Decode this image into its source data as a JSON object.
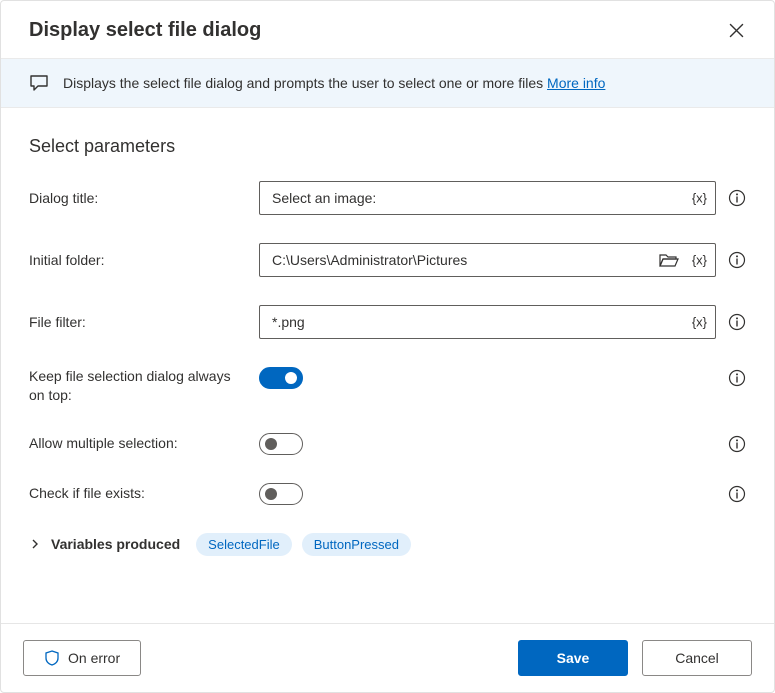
{
  "dialog": {
    "title": "Display select file dialog",
    "banner_text": "Displays the select file dialog and prompts the user to select one or more files ",
    "more_info": "More info"
  },
  "section_title": "Select parameters",
  "fields": {
    "dialog_title": {
      "label": "Dialog title:",
      "value": "Select an image:"
    },
    "initial_folder": {
      "label": "Initial folder:",
      "value": "C:\\Users\\Administrator\\Pictures"
    },
    "file_filter": {
      "label": "File filter:",
      "value": "*.png"
    },
    "keep_on_top": {
      "label": "Keep file selection dialog always on top:",
      "value": true
    },
    "allow_multiple": {
      "label": "Allow multiple selection:",
      "value": false
    },
    "check_exists": {
      "label": "Check if file exists:",
      "value": false
    }
  },
  "variables": {
    "label": "Variables produced",
    "chips": [
      "SelectedFile",
      "ButtonPressed"
    ]
  },
  "footer": {
    "on_error": "On error",
    "save": "Save",
    "cancel": "Cancel"
  },
  "glyphs": {
    "var_braces": "{x}"
  }
}
